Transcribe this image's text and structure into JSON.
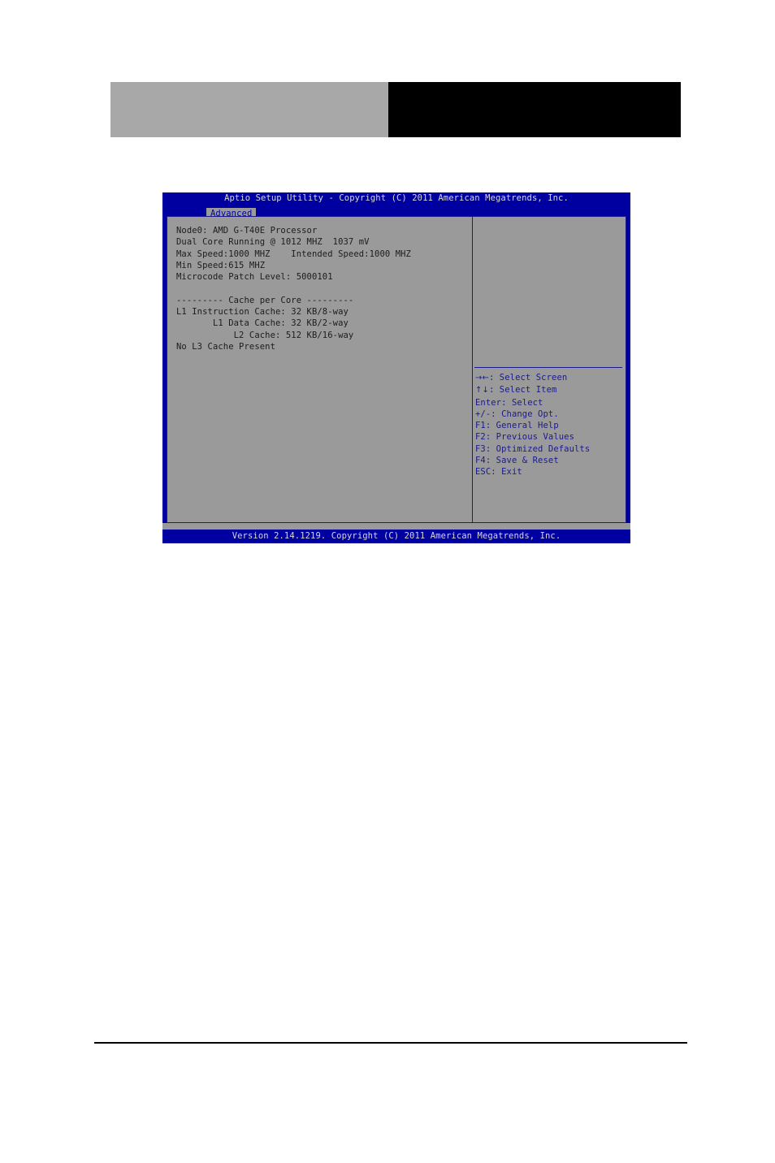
{
  "document": {
    "header_blocks": [
      {
        "name": "logo-placeholder-block",
        "color": "#a8a8a8"
      },
      {
        "name": "title-placeholder-block",
        "color": "#000000"
      }
    ],
    "rule_color": "#000000"
  },
  "bios": {
    "title": "Aptio Setup Utility - Copyright (C) 2011 American Megatrends, Inc.",
    "footer": "Version 2.14.1219. Copyright (C) 2011 American Megatrends, Inc.",
    "tabs": [
      {
        "label": "Advanced",
        "selected": true
      }
    ],
    "colors": {
      "screen_blue": "#0000a0",
      "panel_gray": "#9a9a9a",
      "border_blue": "#1a1a8c",
      "text_dark": "#1c1c1c",
      "text_light": "#d8d8d8"
    },
    "main_panel": {
      "lines": [
        "Node0: AMD G-T40E Processor",
        "Dual Core Running @ 1012 MHZ  1037 mV",
        "Max Speed:1000 MHZ    Intended Speed:1000 MHZ",
        "Min Speed:615 MHZ",
        "Microcode Patch Level: 5000101",
        "",
        "--------- Cache per Core ---------",
        "L1 Instruction Cache: 32 KB/8-way",
        "       L1 Data Cache: 32 KB/2-way",
        "           L2 Cache: 512 KB/16-way",
        "No L3 Cache Present"
      ]
    },
    "help_panel": {
      "items": [
        {
          "key": "→←",
          "label": ": Select Screen"
        },
        {
          "key": "↑↓",
          "label": ": Select Item"
        },
        {
          "key": "Enter",
          "label": ": Select"
        },
        {
          "key": "+/-",
          "label": ": Change Opt."
        },
        {
          "key": "F1",
          "label": ": General Help"
        },
        {
          "key": "F2",
          "label": ": Previous Values"
        },
        {
          "key": "F3",
          "label": ": Optimized Defaults"
        },
        {
          "key": "F4",
          "label": ": Save & Reset"
        },
        {
          "key": "ESC",
          "label": ": Exit"
        }
      ]
    }
  }
}
